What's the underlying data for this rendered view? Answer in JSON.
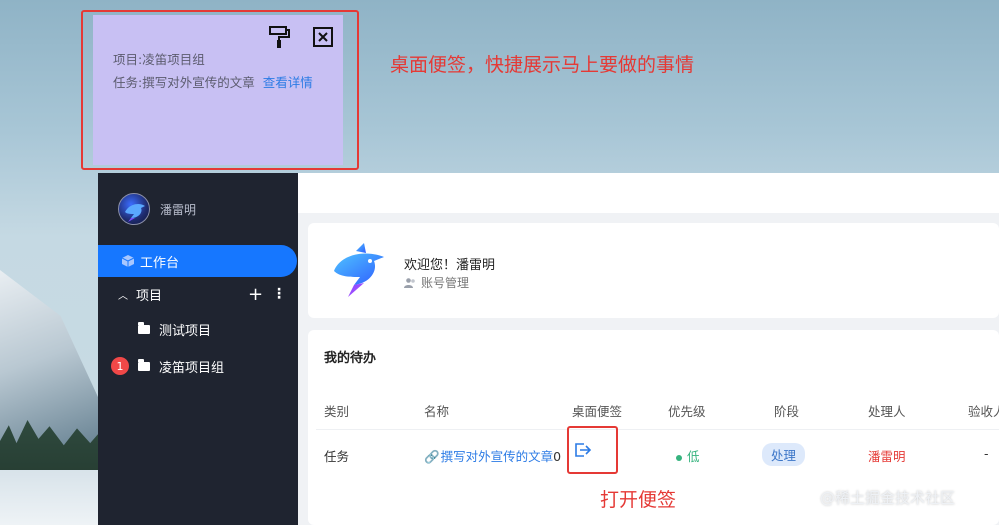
{
  "sticky_note": {
    "project_line": "项目:凌笛项目组",
    "task_line": "任务:撰写对外宣传的文章",
    "detail_link": "查看详情"
  },
  "annotations": {
    "desktop_note": "桌面便签，快捷展示马上要做的事情",
    "open_note": "打开便签"
  },
  "sidebar": {
    "username": "潘雷明",
    "workbench": "工作台",
    "projects_label": "项目",
    "plus": "+",
    "more": "⋮",
    "items": [
      {
        "label": "测试项目"
      },
      {
        "label": "凌笛项目组",
        "badge": "1"
      }
    ]
  },
  "welcome": {
    "greeting": "欢迎您！潘雷明",
    "account_link": "账号管理"
  },
  "todo": {
    "title": "我的待办",
    "headers": [
      "类别",
      "名称",
      "桌面便签",
      "优先级",
      "阶段",
      "处理人",
      "验收人"
    ],
    "row": {
      "category": "任务",
      "name": "撰写对外宣传的文章",
      "name_suffix": "0",
      "priority": "低",
      "stage": "处理",
      "handler": "潘雷明",
      "acceptor": "-"
    }
  },
  "watermark": "@稀土掘金技术社区",
  "colors": {
    "accent": "#1677ff",
    "sticky_bg": "#c8c0f3",
    "annotation_red": "#e53935",
    "sidebar_bg": "#1f2430"
  }
}
